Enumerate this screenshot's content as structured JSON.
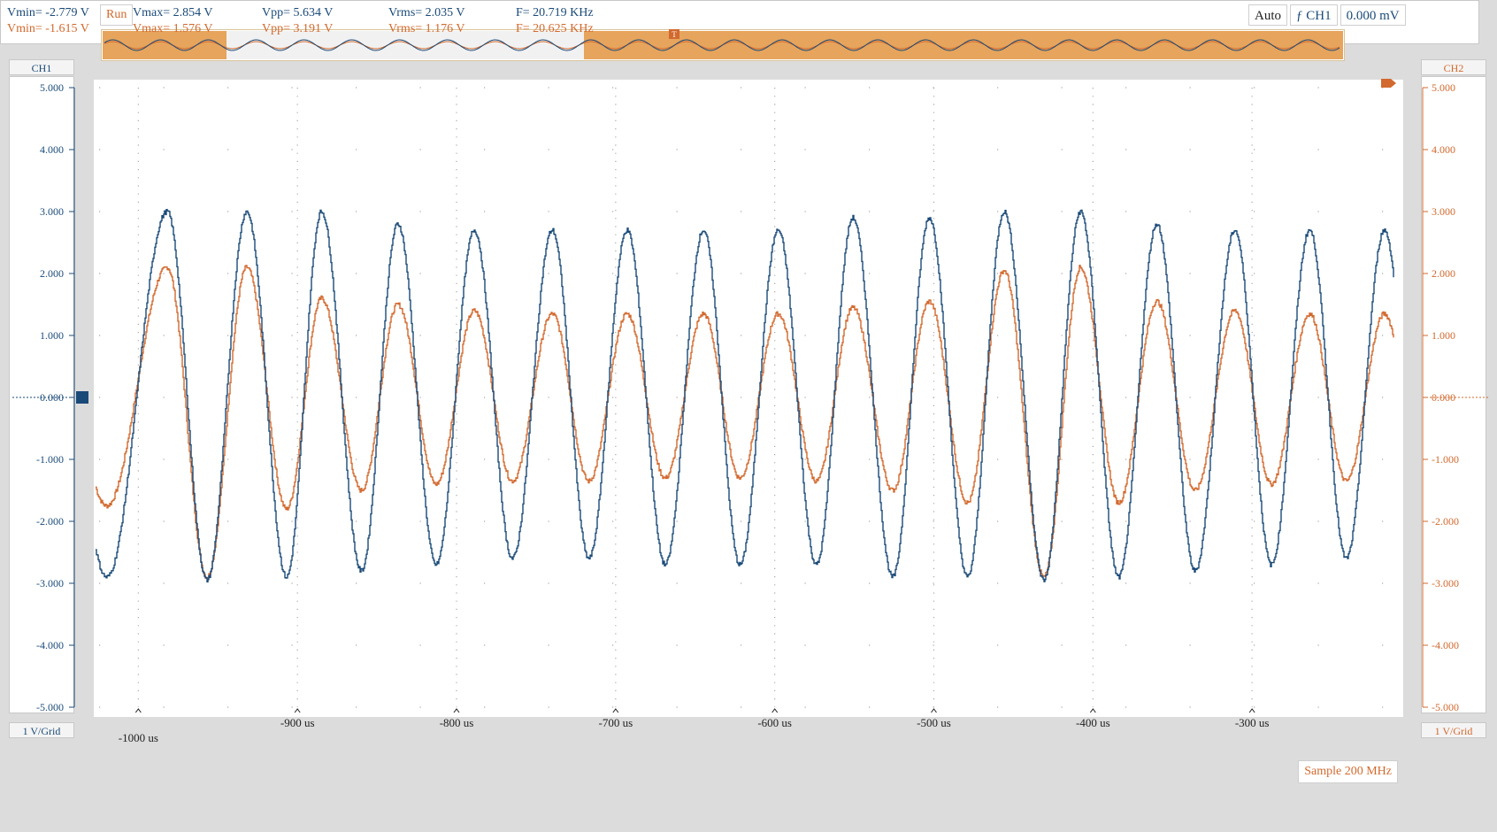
{
  "status": "Run",
  "trigger": {
    "mode": "Auto",
    "channel": "CH1",
    "level": "0.000 mV"
  },
  "channels": {
    "ch1": {
      "name": "CH1",
      "scale": "1 V/Grid",
      "color": "#1a4a78"
    },
    "ch2": {
      "name": "CH2",
      "scale": "1 V/Grid",
      "color": "#d2692e"
    }
  },
  "sample": "Sample 200 MHz",
  "measurements": {
    "ch1": {
      "vmin": "Vmin= -2.779 V",
      "vmax": "Vmax= 2.854 V",
      "vpp": "Vpp= 5.634 V",
      "vrms": "Vrms= 2.035 V",
      "freq": "F= 20.719 KHz"
    },
    "ch2": {
      "vmin": "Vmin= -1.615 V",
      "vmax": "Vmax= 1.576 V",
      "vpp": "Vpp= 3.191 V",
      "vrms": "Vrms= 1.176 V",
      "freq": "F= 20.625 KHz"
    }
  },
  "chart_data": {
    "type": "line",
    "x_unit": "us",
    "xlim": [
      -1028,
      -205
    ],
    "ylim": [
      -5,
      5
    ],
    "y_ticks": [
      "5.000",
      "4.000",
      "3.000",
      "2.000",
      "1.000",
      "0.000",
      "-1.000",
      "-2.000",
      "-3.000",
      "-4.000",
      "-5.000"
    ],
    "x_ticks": [
      {
        "value": -1000,
        "label": "-1000 us"
      },
      {
        "value": -900,
        "label": "-900 us"
      },
      {
        "value": -800,
        "label": "-800 us"
      },
      {
        "value": -700,
        "label": "-700 us"
      },
      {
        "value": -600,
        "label": "-600 us"
      },
      {
        "value": -500,
        "label": "-500 us"
      },
      {
        "value": -400,
        "label": "-400 us"
      },
      {
        "value": -300,
        "label": "-300 us"
      }
    ],
    "grid": true,
    "series": [
      {
        "color": "#1a4a78",
        "peaks_x": [
          -982,
          -932,
          -885,
          -837,
          -789,
          -740,
          -693,
          -645,
          -598,
          -551,
          -503,
          -456,
          -408,
          -360,
          -311,
          -264,
          -217
        ],
        "peaks_y": [
          3.0,
          3.0,
          3.0,
          2.8,
          2.7,
          2.7,
          2.7,
          2.7,
          2.7,
          2.9,
          2.9,
          3.0,
          3.0,
          2.8,
          2.7,
          2.7,
          2.7
        ],
        "troughs_x": [
          -1020,
          -957,
          -907,
          -860,
          -813,
          -765,
          -717,
          -669,
          -622,
          -574,
          -526,
          -479,
          -431,
          -384,
          -336,
          -288,
          -241
        ],
        "troughs_y": [
          -2.9,
          -2.95,
          -2.9,
          -2.8,
          -2.7,
          -2.6,
          -2.6,
          -2.7,
          -2.7,
          -2.7,
          -2.9,
          -2.9,
          -2.95,
          -2.9,
          -2.8,
          -2.7,
          -2.6
        ]
      },
      {
        "color": "#d2692e",
        "peaks_x": [
          -982,
          -932,
          -885,
          -837,
          -789,
          -740,
          -693,
          -645,
          -598,
          -551,
          -503,
          -456,
          -408,
          -360,
          -311,
          -264,
          -217
        ],
        "peaks_y": [
          2.1,
          2.1,
          1.6,
          1.5,
          1.4,
          1.35,
          1.35,
          1.35,
          1.35,
          1.45,
          1.55,
          2.05,
          2.1,
          1.55,
          1.4,
          1.35,
          1.35
        ],
        "troughs_x": [
          -1020,
          -957,
          -907,
          -860,
          -813,
          -765,
          -717,
          -669,
          -622,
          -574,
          -526,
          -479,
          -431,
          -384,
          -336,
          -288,
          -241
        ],
        "troughs_y": [
          -1.75,
          -2.9,
          -1.8,
          -1.5,
          -1.4,
          -1.35,
          -1.35,
          -1.3,
          -1.3,
          -1.35,
          -1.5,
          -1.7,
          -2.9,
          -1.7,
          -1.5,
          -1.4,
          -1.35
        ]
      }
    ]
  }
}
